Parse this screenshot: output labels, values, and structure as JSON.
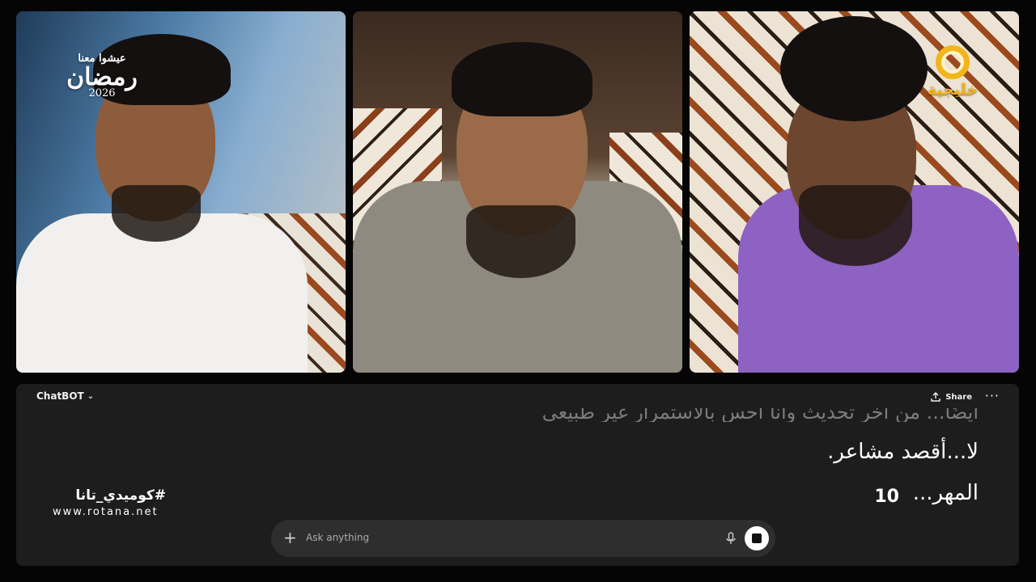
{
  "panels": [
    {
      "name": "left-person",
      "shirt": "white t-shirt"
    },
    {
      "name": "center-person",
      "shirt": "grey overshirt"
    },
    {
      "name": "right-person",
      "shirt": "purple jacket"
    }
  ],
  "logos": {
    "ramadan": {
      "line1": "عيشوا معنا",
      "line2": "رمضان",
      "line3": "2026"
    },
    "rotana": {
      "text": "خليجية"
    }
  },
  "chat": {
    "title": "ChatBOT",
    "share_label": "Share",
    "more_label": "···",
    "messages": [
      "أيضًا... من آخر تحديث وأنا أحس بالاستمرار غير طبيعي",
      "لا...أقصد مشاعر.",
      "المهر..."
    ],
    "counter": "10",
    "composer_placeholder": "Ask anything"
  },
  "overlay": {
    "hashtag": "#كوميدي_تانا",
    "url": "www.rotana.net"
  },
  "colors": {
    "background": "#050505",
    "chat_bg": "#1d1d1d",
    "composer_bg": "#2e2e2e",
    "rotana_gold": "#f1b21a"
  }
}
